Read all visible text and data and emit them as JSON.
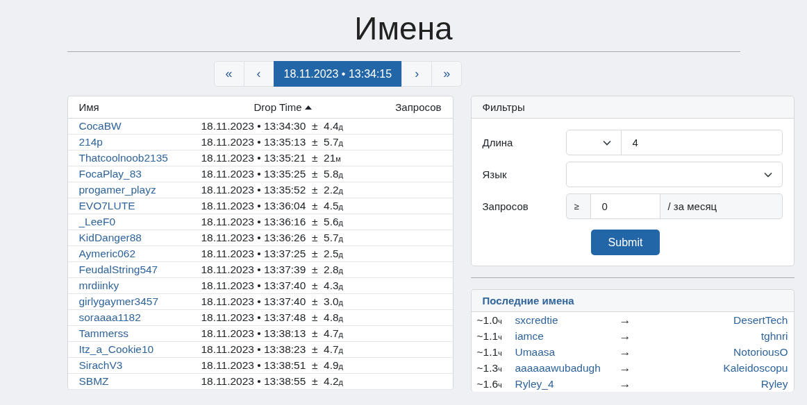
{
  "title": "Имена",
  "pagination": [
    {
      "label": "«",
      "selected": false
    },
    {
      "label": "‹",
      "selected": false
    },
    {
      "label": "18.11.2023 • 13:34:15",
      "selected": true
    },
    {
      "label": "›",
      "selected": false
    },
    {
      "label": "»",
      "selected": false
    }
  ],
  "names_table": {
    "columns": [
      {
        "label": "Имя",
        "sorted": false
      },
      {
        "label": "Drop Time",
        "sorted": true
      },
      {
        "label": "Запросов",
        "sorted": false
      }
    ],
    "rows": [
      {
        "name": "CocaBW",
        "drop_time": "18.11.2023 • 13:34:30  ±  4.4",
        "unit": "д"
      },
      {
        "name": "214p",
        "drop_time": "18.11.2023 • 13:35:13  ±  5.7",
        "unit": "д"
      },
      {
        "name": "Thatcoolnoob2135",
        "drop_time": "18.11.2023 • 13:35:21  ±  21",
        "unit": "м"
      },
      {
        "name": "FocaPlay_83",
        "drop_time": "18.11.2023 • 13:35:25  ±  5.8",
        "unit": "д"
      },
      {
        "name": "progamer_playz",
        "drop_time": "18.11.2023 • 13:35:52  ±  2.2",
        "unit": "д"
      },
      {
        "name": "EVO7LUTE",
        "drop_time": "18.11.2023 • 13:36:04  ±  4.5",
        "unit": "д"
      },
      {
        "name": "_LeeF0",
        "drop_time": "18.11.2023 • 13:36:16  ±  5.6",
        "unit": "д"
      },
      {
        "name": "KidDanger88",
        "drop_time": "18.11.2023 • 13:36:26  ±  5.7",
        "unit": "д"
      },
      {
        "name": "Aymeric062",
        "drop_time": "18.11.2023 • 13:37:25  ±  2.5",
        "unit": "д"
      },
      {
        "name": "FeudalString547",
        "drop_time": "18.11.2023 • 13:37:39  ±  2.8",
        "unit": "д"
      },
      {
        "name": "mrdiinky",
        "drop_time": "18.11.2023 • 13:37:40  ±  4.3",
        "unit": "д"
      },
      {
        "name": "girlygaymer3457",
        "drop_time": "18.11.2023 • 13:37:40  ±  3.0",
        "unit": "д"
      },
      {
        "name": "soraaaa1182",
        "drop_time": "18.11.2023 • 13:37:48  ±  4.8",
        "unit": "д"
      },
      {
        "name": "Tammerss",
        "drop_time": "18.11.2023 • 13:38:13  ±  4.7",
        "unit": "д"
      },
      {
        "name": "Itz_a_Cookie10",
        "drop_time": "18.11.2023 • 13:38:23  ±  4.7",
        "unit": "д"
      },
      {
        "name": "SirachV3",
        "drop_time": "18.11.2023 • 13:38:51  ±  4.9",
        "unit": "д"
      },
      {
        "name": "SBMZ",
        "drop_time": "18.11.2023 • 13:38:55  ±  4.2",
        "unit": "д"
      }
    ]
  },
  "filters": {
    "title": "Фильтры",
    "length": {
      "label": "Длина",
      "value": "4"
    },
    "language": {
      "label": "Язык"
    },
    "requests": {
      "label": "Запросов",
      "prefix": "≥",
      "value": "0",
      "suffix": "/ за месяц"
    },
    "submit": "Submit"
  },
  "recent_names": {
    "title": "Последние имена",
    "rows": [
      {
        "age": "~1.0",
        "unit": "ч",
        "old_name": "sxcredtie",
        "arrow": "→",
        "new_name": "DesertTech"
      },
      {
        "age": "~1.1",
        "unit": "ч",
        "old_name": "iamce",
        "arrow": "→",
        "new_name": "tghnri"
      },
      {
        "age": "~1.1",
        "unit": "ч",
        "old_name": "Umaasa",
        "arrow": "→",
        "new_name": "NotoriousO"
      },
      {
        "age": "~1.3",
        "unit": "ч",
        "old_name": "aaaaaawubadugh",
        "arrow": "→",
        "new_name": "Kaleidoscopu"
      },
      {
        "age": "~1.6",
        "unit": "ч",
        "old_name": "Ryley_4",
        "arrow": "→",
        "new_name": "Ryley"
      }
    ]
  }
}
